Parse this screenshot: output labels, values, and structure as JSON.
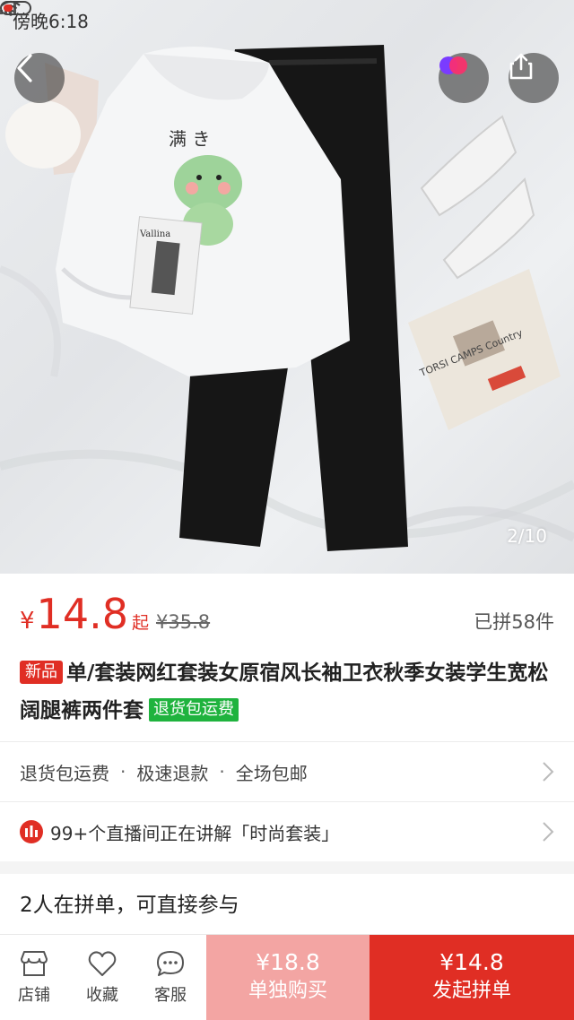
{
  "status_bar": {
    "time": "傍晚6:18"
  },
  "gallery": {
    "counter": "2/10",
    "illustrations": {
      "hoodie_text": "满 き",
      "card_text": "Vallina",
      "newspaper_text": "TORSI CAMPS Country"
    }
  },
  "price": {
    "currency": "¥",
    "current": "14.8",
    "suffix": "起",
    "original": "¥35.8",
    "sold": "已拼58件"
  },
  "title": {
    "tag_new": "新品",
    "text": "单/套装网红套装女原宿风长袖卫衣秋季女装学生宽松阔腿裤两件套",
    "tag_return": "退货包运费"
  },
  "services": {
    "items": [
      "退货包运费",
      "极速退款",
      "全场包邮"
    ],
    "separator": "·"
  },
  "live": {
    "text": "99+个直播间正在讲解「时尚套装」"
  },
  "group_buy": {
    "title": "2人在拼单，可直接参与"
  },
  "bottom_bar": {
    "store": "店铺",
    "favorite": "收藏",
    "service": "客服",
    "solo_price": "¥18.8",
    "solo_label": "单独购买",
    "group_price": "¥14.8",
    "group_label": "发起拼单"
  },
  "colors": {
    "accent_red": "#e02e24",
    "solo_pink": "#f3a5a3",
    "tag_green": "#1fb33e"
  },
  "icons": [
    "back-icon",
    "partner-icon",
    "share-icon",
    "signal-icon",
    "wifi-icon",
    "battery-icon",
    "chevron-right-icon",
    "live-icon",
    "store-icon",
    "heart-icon",
    "chat-icon"
  ]
}
